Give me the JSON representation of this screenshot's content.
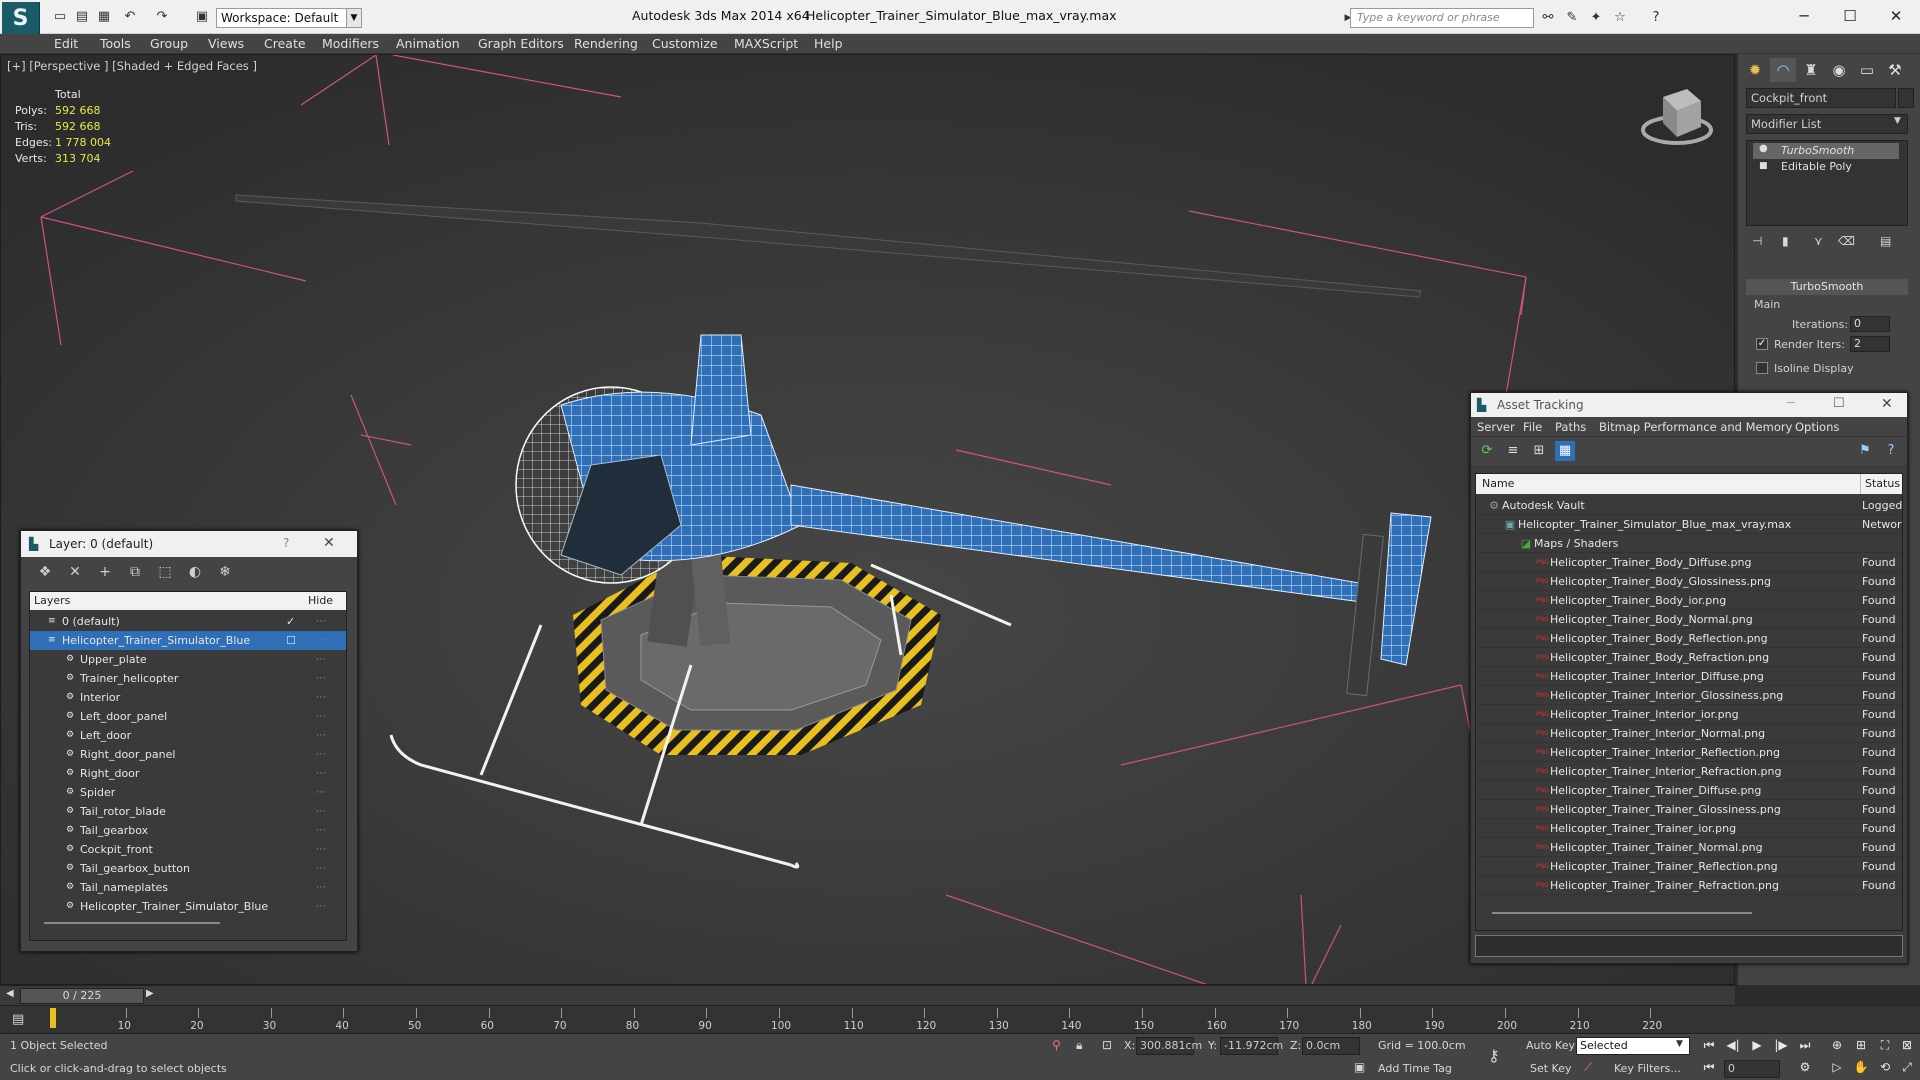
{
  "titlebar": {
    "app_title": "Autodesk 3ds Max  2014 x64",
    "file_title": "Helicopter_Trainer_Simulator_Blue_max_vray.max",
    "workspace_label": "Workspace: Default",
    "search_placeholder": "Type a keyword or phrase"
  },
  "menu": [
    "Edit",
    "Tools",
    "Group",
    "Views",
    "Create",
    "Modifiers",
    "Animation",
    "Graph Editors",
    "Rendering",
    "Customize",
    "MAXScript",
    "Help"
  ],
  "viewport": {
    "label": "[+] [Perspective ] [Shaded + Edged Faces ]",
    "stats": {
      "total_label": "Total",
      "polys_label": "Polys:",
      "polys": "592 668",
      "tris_label": "Tris:",
      "tris": "592 668",
      "edges_label": "Edges:",
      "edges": "1 778 004",
      "verts_label": "Verts:",
      "verts": "313 704"
    }
  },
  "command_panel": {
    "object_name": "Cockpit_front",
    "modifier_list": "Modifier List",
    "stack": [
      "TurboSmooth",
      "Editable Poly"
    ],
    "rollout_title": "TurboSmooth",
    "main_label": "Main",
    "iterations_label": "Iterations:",
    "iterations": "0",
    "render_iters_label": "Render Iters:",
    "render_iters": "2",
    "isoline_label": "Isoline Display"
  },
  "layer_window": {
    "title": "Layer: 0 (default)",
    "col_layers": "Layers",
    "col_hide": "Hide",
    "rows": [
      {
        "name": "0 (default)"
      },
      {
        "name": "Helicopter_Trainer_Simulator_Blue"
      },
      {
        "name": "Upper_plate"
      },
      {
        "name": "Trainer_helicopter"
      },
      {
        "name": "Interior"
      },
      {
        "name": "Left_door_panel"
      },
      {
        "name": "Left_door"
      },
      {
        "name": "Right_door_panel"
      },
      {
        "name": "Right_door"
      },
      {
        "name": "Spider"
      },
      {
        "name": "Tail_rotor_blade"
      },
      {
        "name": "Tail_gearbox"
      },
      {
        "name": "Cockpit_front"
      },
      {
        "name": "Tail_gearbox_button"
      },
      {
        "name": "Tail_nameplates"
      },
      {
        "name": "Helicopter_Trainer_Simulator_Blue"
      }
    ]
  },
  "asset_window": {
    "title": "Asset Tracking",
    "menu": [
      "Server",
      "File",
      "Paths",
      "Bitmap Performance and Memory",
      "Options"
    ],
    "col_name": "Name",
    "col_status": "Status",
    "rows": [
      {
        "name": "Autodesk Vault",
        "status": "Logged"
      },
      {
        "name": "Helicopter_Trainer_Simulator_Blue_max_vray.max",
        "status": "Network"
      },
      {
        "name": "Maps / Shaders",
        "status": ""
      },
      {
        "name": "Helicopter_Trainer_Body_Diffuse.png",
        "status": "Found"
      },
      {
        "name": "Helicopter_Trainer_Body_Glossiness.png",
        "status": "Found"
      },
      {
        "name": "Helicopter_Trainer_Body_ior.png",
        "status": "Found"
      },
      {
        "name": "Helicopter_Trainer_Body_Normal.png",
        "status": "Found"
      },
      {
        "name": "Helicopter_Trainer_Body_Reflection.png",
        "status": "Found"
      },
      {
        "name": "Helicopter_Trainer_Body_Refraction.png",
        "status": "Found"
      },
      {
        "name": "Helicopter_Trainer_Interior_Diffuse.png",
        "status": "Found"
      },
      {
        "name": "Helicopter_Trainer_Interior_Glossiness.png",
        "status": "Found"
      },
      {
        "name": "Helicopter_Trainer_Interior_ior.png",
        "status": "Found"
      },
      {
        "name": "Helicopter_Trainer_Interior_Normal.png",
        "status": "Found"
      },
      {
        "name": "Helicopter_Trainer_Interior_Reflection.png",
        "status": "Found"
      },
      {
        "name": "Helicopter_Trainer_Interior_Refraction.png",
        "status": "Found"
      },
      {
        "name": "Helicopter_Trainer_Trainer_Diffuse.png",
        "status": "Found"
      },
      {
        "name": "Helicopter_Trainer_Trainer_Glossiness.png",
        "status": "Found"
      },
      {
        "name": "Helicopter_Trainer_Trainer_ior.png",
        "status": "Found"
      },
      {
        "name": "Helicopter_Trainer_Trainer_Normal.png",
        "status": "Found"
      },
      {
        "name": "Helicopter_Trainer_Trainer_Reflection.png",
        "status": "Found"
      },
      {
        "name": "Helicopter_Trainer_Trainer_Refraction.png",
        "status": "Found"
      }
    ]
  },
  "timeline": {
    "frame_counter": "0 / 225",
    "ticks": [
      "10",
      "20",
      "30",
      "40",
      "50",
      "60",
      "70",
      "80",
      "90",
      "100",
      "110",
      "120",
      "130",
      "140",
      "150",
      "160",
      "170",
      "180",
      "190",
      "200",
      "210",
      "220"
    ]
  },
  "statusbar": {
    "selection": "1 Object Selected",
    "prompt": "Click or click-and-drag to select objects",
    "x_label": "X:",
    "x": "300.881cm",
    "y_label": "Y:",
    "y": "-11.972cm",
    "z_label": "Z:",
    "z": "0.0cm",
    "grid": "Grid = 100.0cm",
    "add_time_tag": "Add Time Tag",
    "auto_key": "Auto Key",
    "set_key": "Set Key",
    "selected": "Selected",
    "key_filters": "Key Filters...",
    "frame": "0"
  },
  "colors": {
    "accent_blue": "#2f6fb8",
    "stats_yellow": "#e8e848",
    "grid_pink": "#d0508a",
    "hazard_yellow": "#e8c020"
  }
}
